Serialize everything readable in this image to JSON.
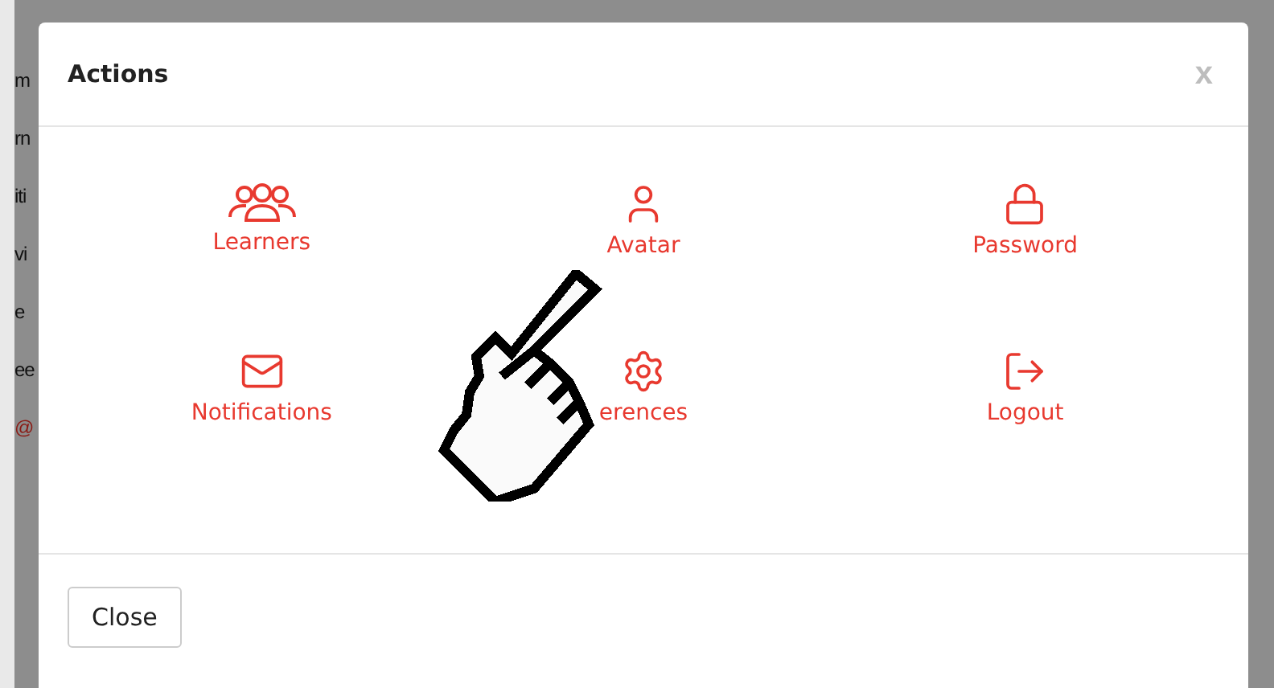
{
  "background_fragments": [
    "m",
    "rn",
    "iti",
    "vi",
    "e",
    "ee",
    "@"
  ],
  "dialog": {
    "title": "Actions",
    "close_glyph": "x",
    "actions": [
      {
        "kind": "learners",
        "label": "Learners"
      },
      {
        "kind": "avatar",
        "label": "Avatar"
      },
      {
        "kind": "password",
        "label": "Password"
      },
      {
        "kind": "notifications",
        "label": "Notifications"
      },
      {
        "kind": "preferences",
        "label": "erences"
      },
      {
        "kind": "logout",
        "label": "Logout"
      }
    ],
    "buttons": [
      "Close"
    ]
  }
}
